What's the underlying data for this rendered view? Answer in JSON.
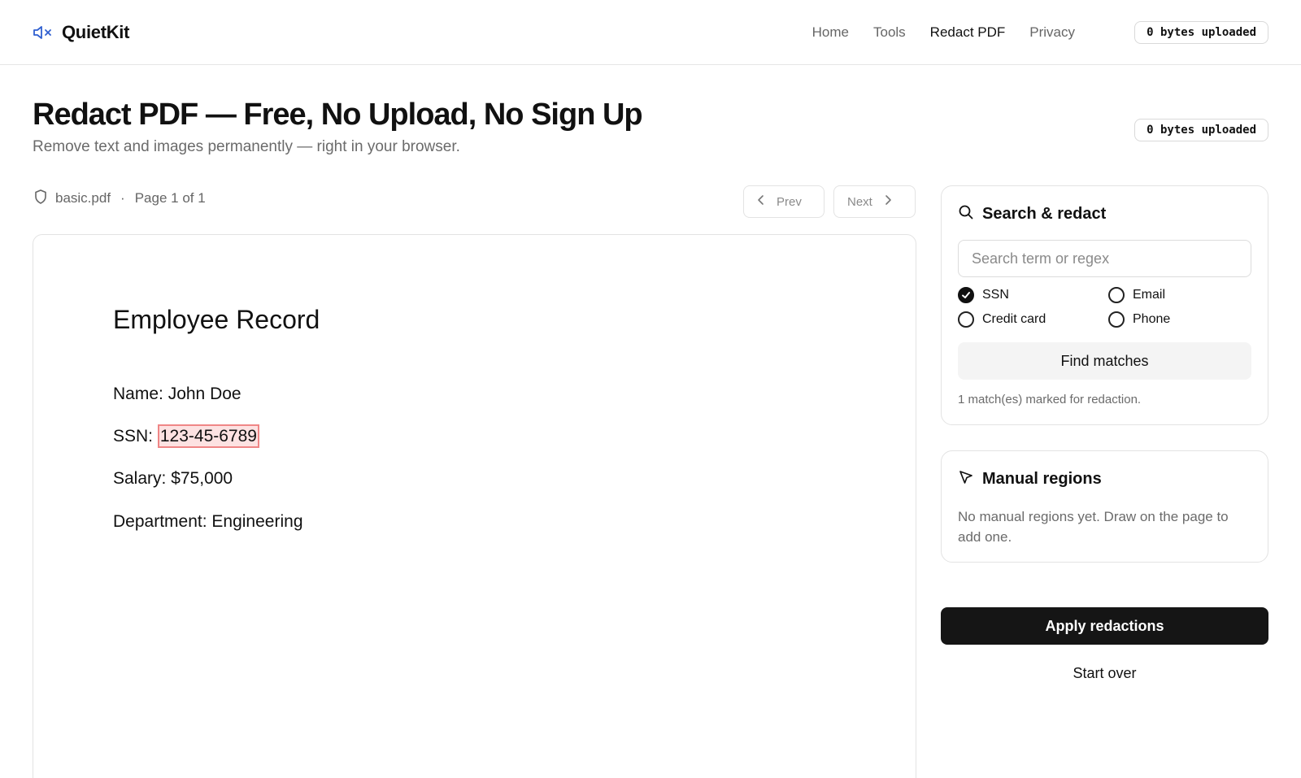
{
  "header": {
    "brand": "QuietKit",
    "brand_icon": "speaker-muted-icon",
    "accent_color": "#2f5fd0",
    "nav": [
      {
        "label": "Home",
        "active": false
      },
      {
        "label": "Tools",
        "active": false
      },
      {
        "label": "Redact PDF",
        "active": true
      },
      {
        "label": "Privacy",
        "active": false
      }
    ],
    "upload_badge": "0 bytes uploaded"
  },
  "page": {
    "title": "Redact PDF — Free, No Upload, No Sign Up",
    "subtitle": "Remove text and images permanently — right in your browser.",
    "upload_badge": "0 bytes uploaded"
  },
  "document": {
    "icon": "shield-icon",
    "filename": "basic.pdf",
    "separator": "·",
    "page_indicator": "Page 1 of 1",
    "prev_label": "Prev",
    "next_label": "Next",
    "content": {
      "title": "Employee Record",
      "lines": [
        {
          "label": "Name:",
          "value": "John Doe"
        },
        {
          "label": "SSN:",
          "value": "123-45-6789",
          "redacted": true
        },
        {
          "label": "Salary:",
          "value": "$75,000"
        },
        {
          "label": "Department:",
          "value": "Engineering"
        }
      ],
      "redaction_colors": {
        "fill": "#fde2e2",
        "border": "#ef8686"
      }
    }
  },
  "search_panel": {
    "icon": "search-icon",
    "title": "Search & redact",
    "placeholder": "Search term or regex",
    "value": "",
    "options": [
      {
        "label": "SSN",
        "checked": true
      },
      {
        "label": "Email",
        "checked": false
      },
      {
        "label": "Credit card",
        "checked": false
      },
      {
        "label": "Phone",
        "checked": false
      }
    ],
    "find_button": "Find matches",
    "status": "1 match(es) marked for redaction."
  },
  "manual_panel": {
    "icon": "cursor-arrow-icon",
    "title": "Manual regions",
    "empty_text": "No manual regions yet. Draw on the page to add one."
  },
  "actions": {
    "apply": "Apply redactions",
    "start_over": "Start over"
  }
}
